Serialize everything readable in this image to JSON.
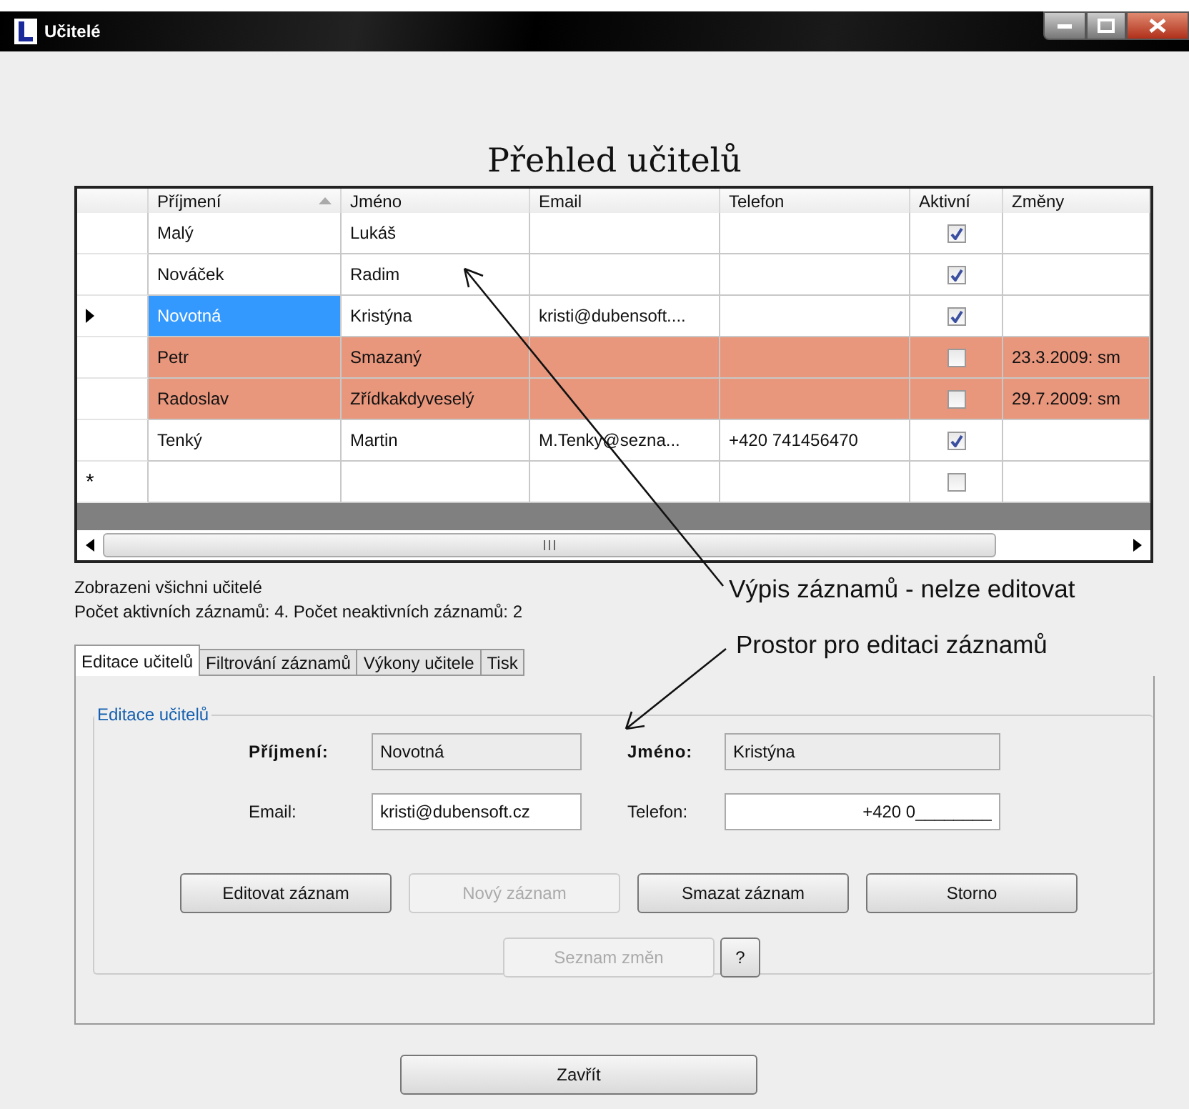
{
  "window": {
    "title": "Učitelé"
  },
  "heading": "Přehled učitelů",
  "grid": {
    "columns": [
      {
        "label": "Příjmení",
        "sorted": true
      },
      {
        "label": "Jméno",
        "sorted": false
      },
      {
        "label": "Email",
        "sorted": false
      },
      {
        "label": "Telefon",
        "sorted": false
      },
      {
        "label": "Aktivní",
        "sorted": false
      },
      {
        "label": "Změny",
        "sorted": false
      }
    ],
    "rows": [
      {
        "surname": "Malý",
        "name": "Lukáš",
        "email": "",
        "phone": "",
        "active": true,
        "changes": "",
        "current": false,
        "deleted": false
      },
      {
        "surname": "Nováček",
        "name": "Radim",
        "email": "",
        "phone": "",
        "active": true,
        "changes": "",
        "current": false,
        "deleted": false
      },
      {
        "surname": "Novotná",
        "name": "Kristýna",
        "email": "kristi@dubensoft....",
        "phone": "",
        "active": true,
        "changes": "",
        "current": true,
        "deleted": false
      },
      {
        "surname": "Petr",
        "name": "Smazaný",
        "email": "",
        "phone": "",
        "active": false,
        "changes": "23.3.2009: sm",
        "current": false,
        "deleted": true
      },
      {
        "surname": "Radoslav",
        "name": "Zřídkakdyveselý",
        "email": "",
        "phone": "",
        "active": false,
        "changes": "29.7.2009: sm",
        "current": false,
        "deleted": true
      },
      {
        "surname": "Tenký",
        "name": "Martin",
        "email": "M.Tenky@sezna...",
        "phone": "+420 741456470",
        "active": true,
        "changes": "",
        "current": false,
        "deleted": false
      }
    ],
    "new_row": {
      "marker": "*",
      "active": false
    }
  },
  "status": [
    "Zobrazeni všichni učitelé",
    "Počet aktivních záznamů: 4. Počet neaktivních záznamů: 2"
  ],
  "annotations": [
    "Výpis záznamů - nelze editovat",
    "Prostor pro editaci záznamů"
  ],
  "tabs": [
    {
      "label": "Editace učitelů",
      "selected": true
    },
    {
      "label": "Filtrování záznamů",
      "selected": false
    },
    {
      "label": "Výkony učitele",
      "selected": false
    },
    {
      "label": "Tisk",
      "selected": false
    }
  ],
  "group": {
    "title": "Editace učitelů",
    "fields": [
      {
        "label": "Příjmení:",
        "bold": true,
        "value": "Novotná",
        "readonly": true
      },
      {
        "label": "Jméno:",
        "bold": true,
        "value": "Kristýna",
        "readonly": true
      },
      {
        "label": "Email:",
        "bold": false,
        "value": "kristi@dubensoft.cz",
        "readonly": false
      },
      {
        "label": "Telefon:",
        "bold": false,
        "value": "+420 0________",
        "readonly": false
      }
    ],
    "buttons": [
      {
        "label": "Editovat záznam",
        "disabled": false
      },
      {
        "label": "Nový záznam",
        "disabled": true
      },
      {
        "label": "Smazat záznam",
        "disabled": false
      },
      {
        "label": "Storno",
        "disabled": false
      }
    ],
    "secondary_buttons": [
      {
        "label": "Seznam změn",
        "disabled": true
      },
      {
        "label": "?",
        "disabled": false
      }
    ]
  },
  "close_button": "Zavřít"
}
